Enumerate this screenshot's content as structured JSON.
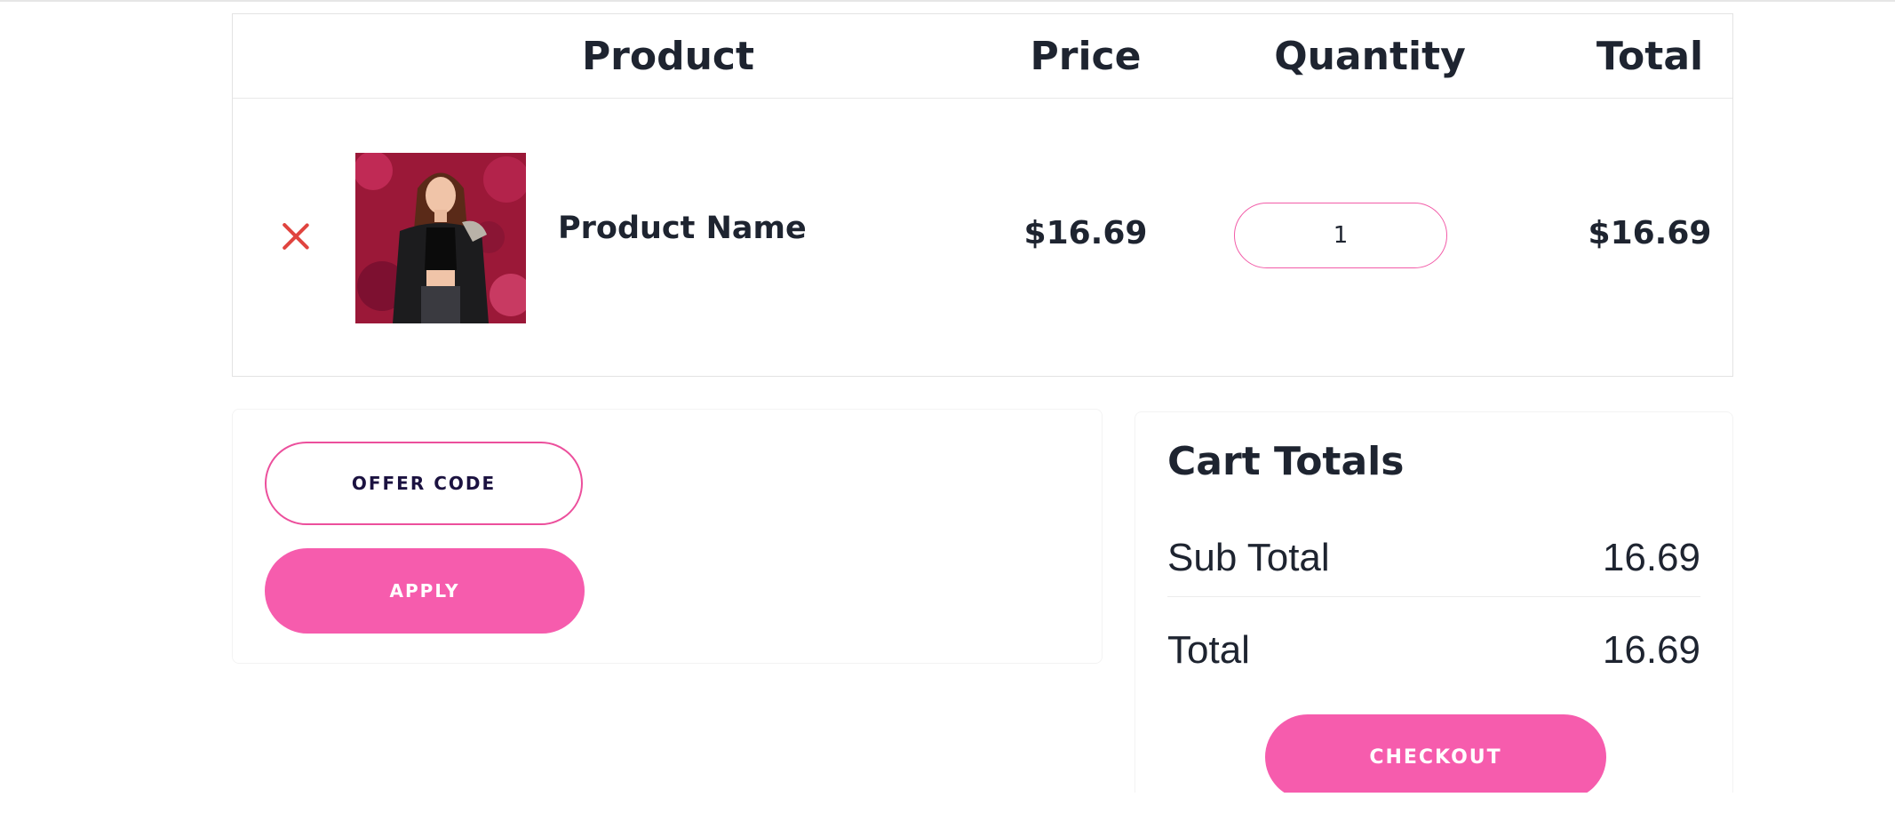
{
  "cart_table": {
    "headers": {
      "product": "Product",
      "price": "Price",
      "quantity": "Quantity",
      "total": "Total"
    },
    "rows": [
      {
        "remove_icon": "close-icon",
        "product_name": "Product Name",
        "price": "$16.69",
        "quantity": "1",
        "total": "$16.69"
      }
    ]
  },
  "coupon": {
    "placeholder": "OFFER CODE",
    "apply_label": "APPLY"
  },
  "cart_totals": {
    "title": "Cart Totals",
    "sub_total_label": "Sub Total",
    "sub_total_value": "16.69",
    "total_label": "Total",
    "total_value": "16.69",
    "checkout_label": "CHECKOUT"
  },
  "colors": {
    "accent_pink": "#f65cad",
    "remove_red": "#e0443f",
    "text_dark": "#1e2430"
  }
}
